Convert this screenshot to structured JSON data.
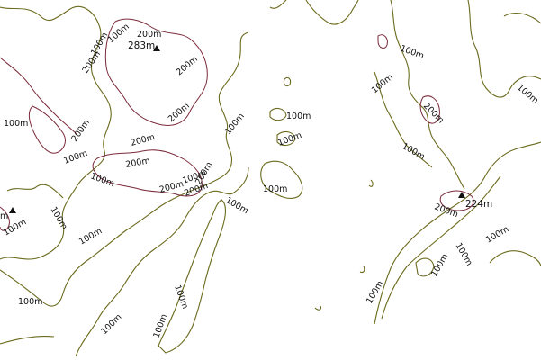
{
  "map": {
    "contour_colors": {
      "contour_100": "#6b6a1d",
      "contour_200": "#7a2a3a",
      "background": "#ffffff"
    },
    "peaks": [
      {
        "label": "283m",
        "icon": "triangle-peak-icon"
      },
      {
        "label": "224m",
        "icon": "triangle-peak-icon"
      },
      {
        "label": "m",
        "icon": "triangle-peak-icon"
      }
    ],
    "contour_labels": [
      "200m",
      "200m",
      "200m",
      "100m",
      "200m",
      "100m",
      "200m",
      "200m",
      "200m",
      "200m",
      "100m",
      "100m",
      "100m",
      "200m",
      "100m",
      "100m",
      "100m",
      "100m",
      "100m",
      "100m",
      "100m",
      "100m",
      "100m",
      "100m",
      "100m",
      "100m",
      "100m",
      "100m",
      "100m",
      "100m",
      "200m",
      "200m",
      "100m",
      "100m",
      "100m",
      "100m",
      "100m",
      "200m",
      "100m",
      "100m",
      "100m"
    ]
  }
}
